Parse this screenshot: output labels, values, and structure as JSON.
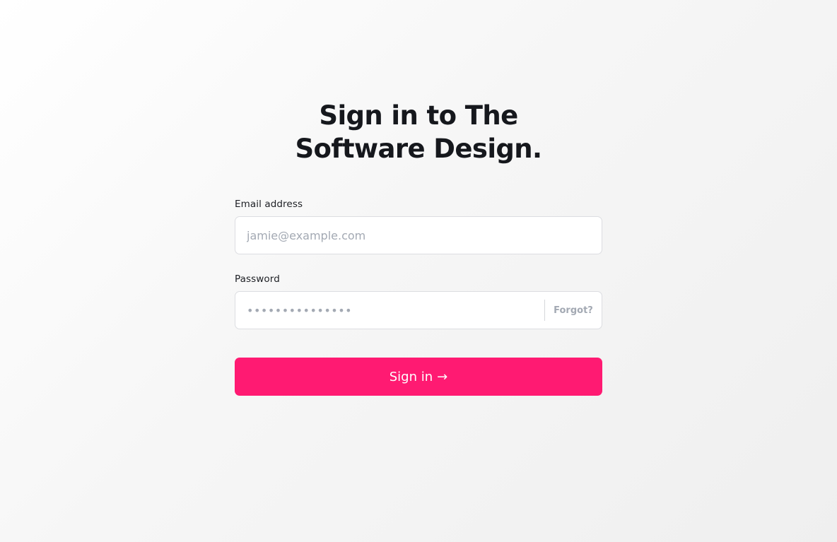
{
  "page": {
    "title": "Sign in to The Software Design."
  },
  "form": {
    "email": {
      "label": "Email address",
      "placeholder": "jamie@example.com",
      "value": ""
    },
    "password": {
      "label": "Password",
      "placeholder": "•••••••••••••••",
      "value": "",
      "forgot_label": "Forgot?"
    },
    "submit": {
      "label": "Sign in",
      "icon": "arrow-right-icon",
      "icon_glyph": "→"
    }
  },
  "colors": {
    "accent": "#ff1a72",
    "text": "#16181d",
    "placeholder": "#a3a9b3",
    "border": "#dcdde1"
  }
}
